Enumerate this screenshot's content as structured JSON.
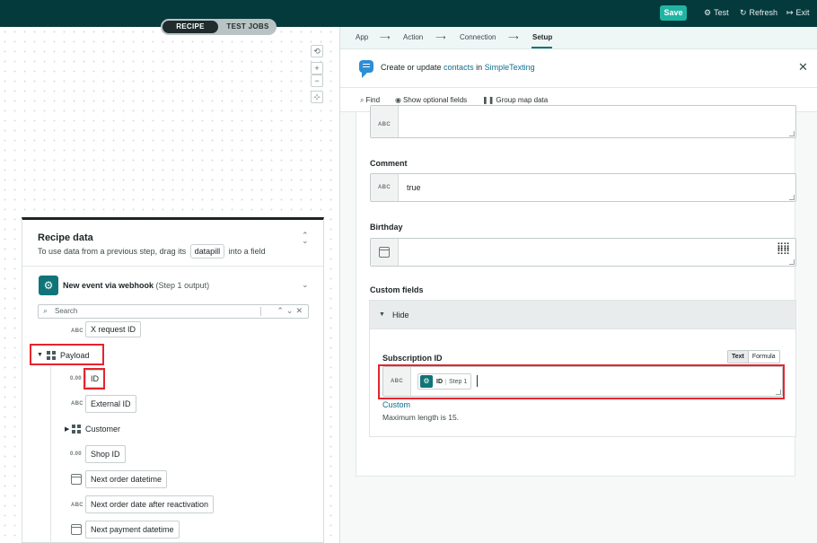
{
  "topbar": {
    "tabs": [
      {
        "label": "RECIPE",
        "active": true
      },
      {
        "label": "TEST JOBS",
        "active": false
      }
    ],
    "save_label": "Save",
    "test_label": "Test",
    "refresh_label": "Refresh",
    "exit_label": "Exit",
    "accent": "#20b5a2",
    "bg": "#053a3d"
  },
  "canvas": {
    "zoom_controls": [
      {
        "icon": "reset-icon",
        "glyph": "⟲"
      },
      {
        "icon": "zoom-in-icon",
        "glyph": "+"
      },
      {
        "icon": "zoom-out-icon",
        "glyph": "−"
      },
      {
        "icon": "fit-icon",
        "glyph": "⊹"
      }
    ]
  },
  "recipe_data": {
    "title": "Recipe data",
    "subtitle_before": "To use data from a previous step, drag its",
    "subtitle_pill": "datapill",
    "subtitle_after": "into a field",
    "step_title": "New event via webhook",
    "step_suffix": "(Step 1 output)",
    "search_placeholder": "Search",
    "items": {
      "x_request_id": {
        "type": "ABC",
        "label": "X request ID"
      },
      "payload": {
        "label": "Payload"
      },
      "id": {
        "type": "0.00",
        "label": "ID"
      },
      "external_id": {
        "type": "ABC",
        "label": "External ID"
      },
      "customer": {
        "label": "Customer"
      },
      "shop_id": {
        "type": "0.00",
        "label": "Shop ID"
      },
      "next_order_datetime": {
        "label": "Next order datetime"
      },
      "next_order_date_after_reactivation": {
        "type": "ABC",
        "label": "Next order date after reactivation"
      },
      "next_payment_datetime": {
        "label": "Next payment datetime"
      }
    }
  },
  "right_panel": {
    "breadcrumb": [
      "App",
      "Action",
      "Connection",
      "Setup"
    ],
    "breadcrumb_sep": "⟶",
    "header_before": "Create or update ",
    "header_link1": "contacts",
    "header_mid": " in ",
    "header_link2": "SimpleTexting",
    "toolbar": {
      "find": "Find",
      "optional": "Show optional fields",
      "group": "Group map data"
    },
    "fields": {
      "top": {
        "type": "ABC",
        "value": ""
      },
      "comment": {
        "label": "Comment",
        "type": "ABC",
        "value": "true"
      },
      "birthday": {
        "label": "Birthday",
        "value": ""
      },
      "custom_fields": {
        "label": "Custom fields",
        "toggle_label": "Hide"
      },
      "subscription_id": {
        "label": "Subscription ID",
        "type": "ABC",
        "mode_text": "Text",
        "mode_formula": "Formula",
        "pill_name": "ID",
        "pill_step": "Step 1",
        "link": "Custom",
        "hint": "Maximum length is 15."
      }
    }
  }
}
